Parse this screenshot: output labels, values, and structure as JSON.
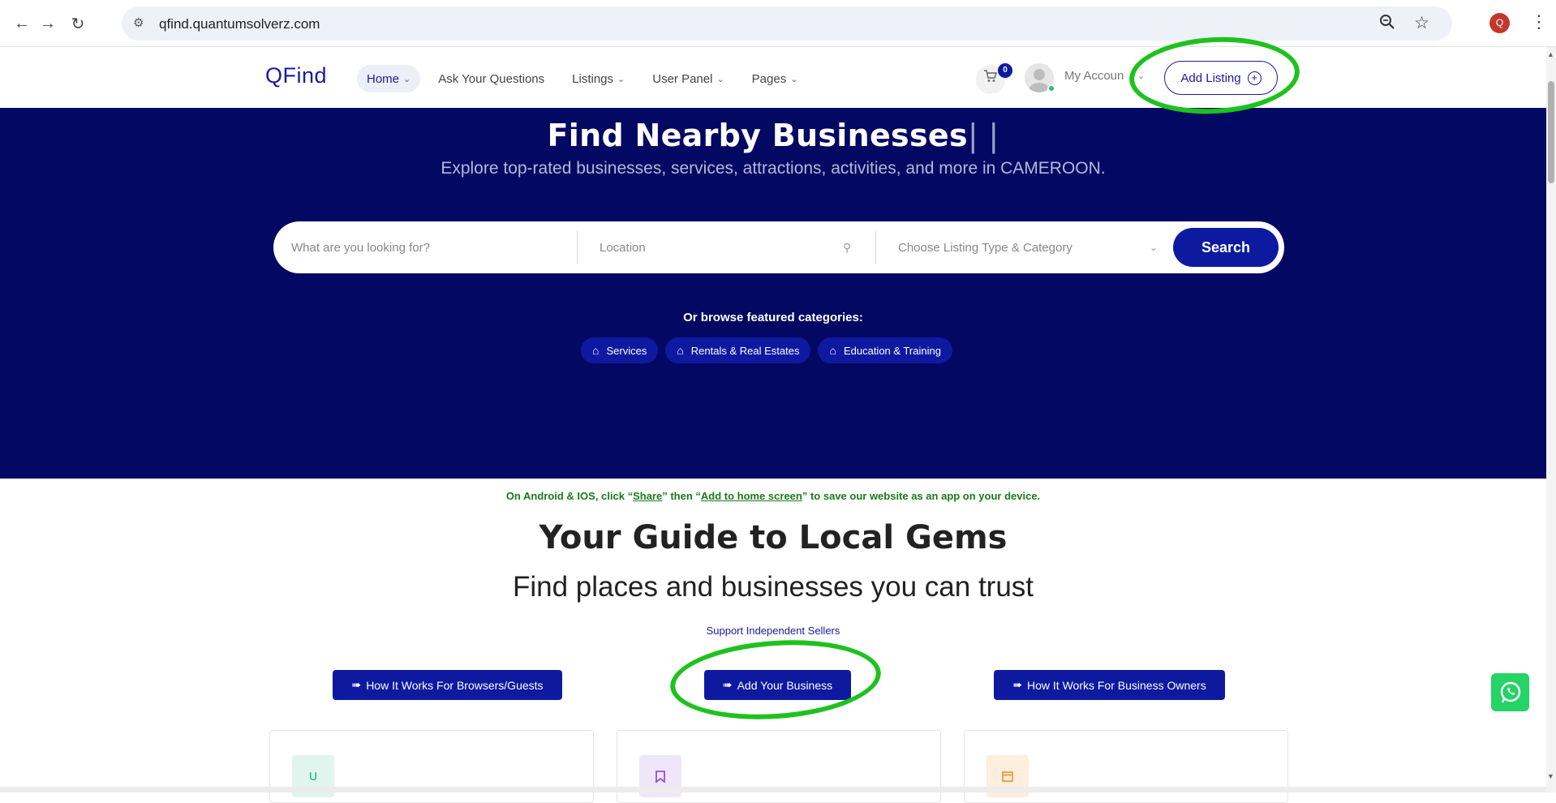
{
  "browser": {
    "url": "qfind.quantumsolverz.com",
    "profile_initial": "Q"
  },
  "header": {
    "logo": "QFind",
    "nav": [
      {
        "label": "Home",
        "has_caret": true
      },
      {
        "label": "Ask Your Questions",
        "has_caret": false
      },
      {
        "label": "Listings",
        "has_caret": true
      },
      {
        "label": "User Panel",
        "has_caret": true
      },
      {
        "label": "Pages",
        "has_caret": true
      }
    ],
    "cart_count": "0",
    "account_label": "My Accoun",
    "add_listing_label": "Add Listing"
  },
  "hero": {
    "title": "Find Nearby Businesses",
    "title_cursor": "| |",
    "subtitle": "Explore top-rated businesses, services, attractions, activities, and more in CAMEROON.",
    "search_placeholder": "What are you looking for?",
    "location_placeholder": "Location",
    "category_placeholder": "Choose Listing Type & Category",
    "search_button": "Search",
    "browse_label": "Or browse featured categories:",
    "categories": [
      "Services",
      "Rentals & Real Estates",
      "Education & Training"
    ]
  },
  "content": {
    "tip_pre": "On Android & IOS, click “",
    "tip_share": "Share",
    "tip_mid": "” then “",
    "tip_add": "Add to home screen",
    "tip_post": "” to save our website as an app on your device.",
    "guide_title": "Your Guide to Local Gems",
    "guide_subtitle": "Find places and businesses you can trust",
    "support_link": "Support Independent Sellers",
    "cta_browsers": "How It Works For Browsers/Guests",
    "cta_add_business": "Add Your Business",
    "cta_owners": "How It Works For Business Owners"
  },
  "colors": {
    "brand": "#0d1aa0",
    "hero_bg": "#030863",
    "annotation": "#1ec21e",
    "tip_green": "#1a7a1a"
  }
}
